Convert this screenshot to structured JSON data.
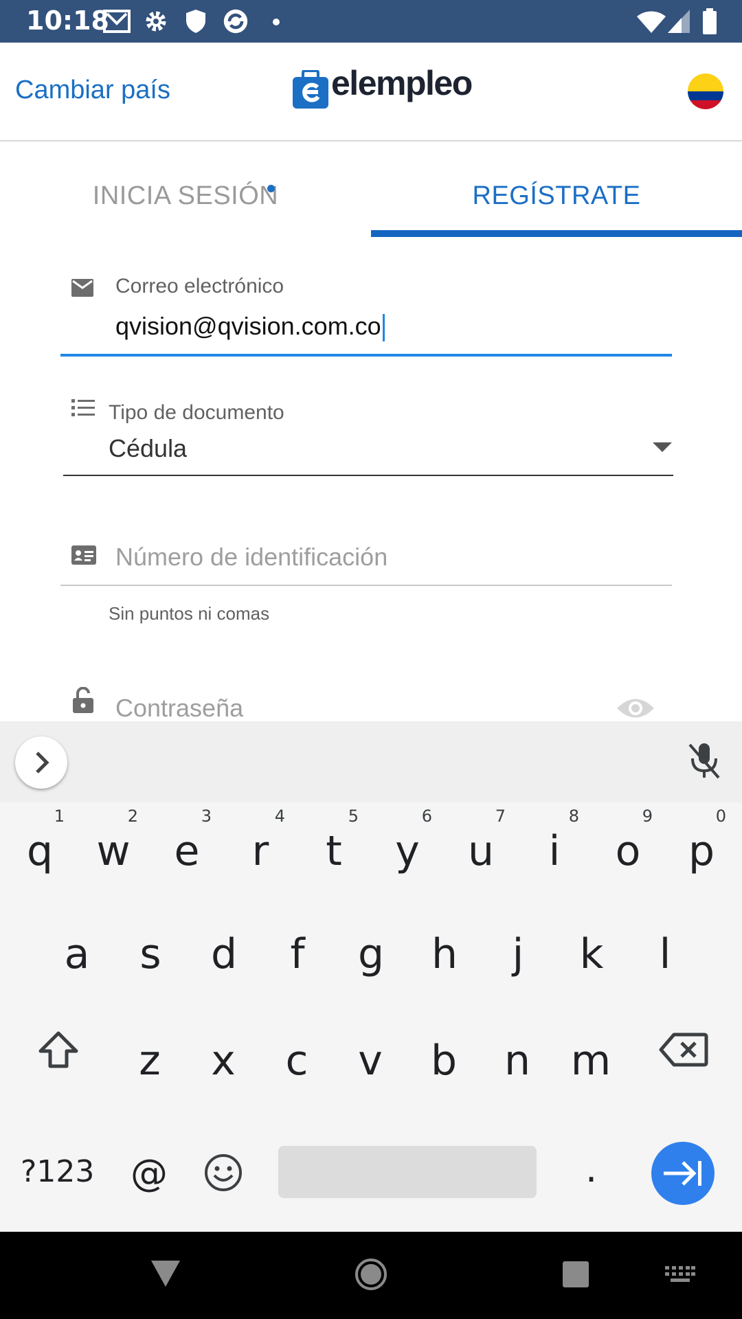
{
  "status_bar": {
    "time": "10:18",
    "icons": [
      "gmail-icon",
      "settings-icon",
      "shield-icon",
      "sync-icon",
      "notification-dot-icon"
    ],
    "right_icons": [
      "wifi-icon",
      "signal-icon",
      "battery-icon"
    ]
  },
  "header": {
    "change_country": "Cambiar país",
    "logo_text": "elempleo",
    "flag_colors": [
      "#fcd116",
      "#003893",
      "#ce1126"
    ]
  },
  "tabs": {
    "login": "INICIA SESIÓN",
    "register": "REGÍSTRATE",
    "active": "register"
  },
  "form": {
    "email": {
      "label": "Correo electrónico",
      "value": "qvision@qvision.com.co"
    },
    "document_type": {
      "label": "Tipo de documento",
      "selected": "Cédula"
    },
    "id_number": {
      "placeholder": "Número de identificación",
      "helper": "Sin puntos ni comas"
    },
    "password": {
      "placeholder": "Contraseña"
    }
  },
  "keyboard": {
    "row1": [
      "q",
      "w",
      "e",
      "r",
      "t",
      "y",
      "u",
      "i",
      "o",
      "p"
    ],
    "row1_hints": [
      "1",
      "2",
      "3",
      "4",
      "5",
      "6",
      "7",
      "8",
      "9",
      "0"
    ],
    "row2": [
      "a",
      "s",
      "d",
      "f",
      "g",
      "h",
      "j",
      "k",
      "l"
    ],
    "row3": [
      "z",
      "x",
      "c",
      "v",
      "b",
      "n",
      "m"
    ],
    "symbols_key": "?123",
    "at_key": "@",
    "period_key": "."
  },
  "colors": {
    "accent": "#1b6fc4",
    "status_bar": "#33527c",
    "tab_indicator": "#1565c0",
    "focus_underline": "#1e88e5",
    "enter_key": "#2f80ed"
  }
}
